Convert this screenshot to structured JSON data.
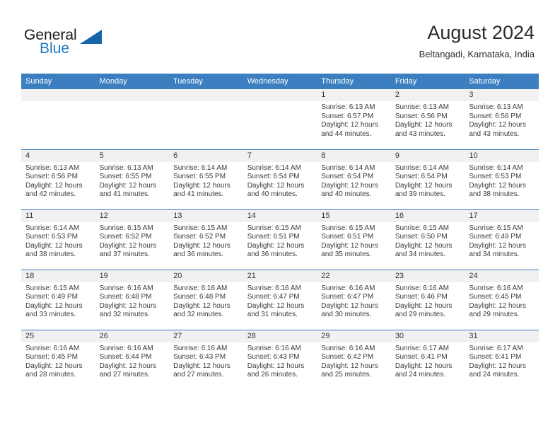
{
  "brand": {
    "name_part1": "General",
    "name_part2": "Blue"
  },
  "header": {
    "title": "August 2024",
    "subtitle": "Beltangadi, Karnataka, India"
  },
  "weekday_headers": [
    "Sunday",
    "Monday",
    "Tuesday",
    "Wednesday",
    "Thursday",
    "Friday",
    "Saturday"
  ],
  "colors": {
    "header_blue": "#3c7fc1",
    "band_gray": "#f1f1f1",
    "logo_blue": "#1f7cc4",
    "text": "#3b3b3b"
  },
  "labels": {
    "sunrise_prefix": "Sunrise:",
    "sunset_prefix": "Sunset:",
    "daylight_prefix": "Daylight:"
  },
  "weeks": [
    [
      {
        "day": "",
        "sunrise": "",
        "sunset": "",
        "daylight_l1": "",
        "daylight_l2": "",
        "empty": true
      },
      {
        "day": "",
        "sunrise": "",
        "sunset": "",
        "daylight_l1": "",
        "daylight_l2": "",
        "empty": true
      },
      {
        "day": "",
        "sunrise": "",
        "sunset": "",
        "daylight_l1": "",
        "daylight_l2": "",
        "empty": true
      },
      {
        "day": "",
        "sunrise": "",
        "sunset": "",
        "daylight_l1": "",
        "daylight_l2": "",
        "empty": true
      },
      {
        "day": "1",
        "sunrise": "Sunrise: 6:13 AM",
        "sunset": "Sunset: 6:57 PM",
        "daylight_l1": "Daylight: 12 hours",
        "daylight_l2": "and 44 minutes.",
        "empty": false
      },
      {
        "day": "2",
        "sunrise": "Sunrise: 6:13 AM",
        "sunset": "Sunset: 6:56 PM",
        "daylight_l1": "Daylight: 12 hours",
        "daylight_l2": "and 43 minutes.",
        "empty": false
      },
      {
        "day": "3",
        "sunrise": "Sunrise: 6:13 AM",
        "sunset": "Sunset: 6:56 PM",
        "daylight_l1": "Daylight: 12 hours",
        "daylight_l2": "and 43 minutes.",
        "empty": false
      }
    ],
    [
      {
        "day": "4",
        "sunrise": "Sunrise: 6:13 AM",
        "sunset": "Sunset: 6:56 PM",
        "daylight_l1": "Daylight: 12 hours",
        "daylight_l2": "and 42 minutes.",
        "empty": false
      },
      {
        "day": "5",
        "sunrise": "Sunrise: 6:13 AM",
        "sunset": "Sunset: 6:55 PM",
        "daylight_l1": "Daylight: 12 hours",
        "daylight_l2": "and 41 minutes.",
        "empty": false
      },
      {
        "day": "6",
        "sunrise": "Sunrise: 6:14 AM",
        "sunset": "Sunset: 6:55 PM",
        "daylight_l1": "Daylight: 12 hours",
        "daylight_l2": "and 41 minutes.",
        "empty": false
      },
      {
        "day": "7",
        "sunrise": "Sunrise: 6:14 AM",
        "sunset": "Sunset: 6:54 PM",
        "daylight_l1": "Daylight: 12 hours",
        "daylight_l2": "and 40 minutes.",
        "empty": false
      },
      {
        "day": "8",
        "sunrise": "Sunrise: 6:14 AM",
        "sunset": "Sunset: 6:54 PM",
        "daylight_l1": "Daylight: 12 hours",
        "daylight_l2": "and 40 minutes.",
        "empty": false
      },
      {
        "day": "9",
        "sunrise": "Sunrise: 6:14 AM",
        "sunset": "Sunset: 6:54 PM",
        "daylight_l1": "Daylight: 12 hours",
        "daylight_l2": "and 39 minutes.",
        "empty": false
      },
      {
        "day": "10",
        "sunrise": "Sunrise: 6:14 AM",
        "sunset": "Sunset: 6:53 PM",
        "daylight_l1": "Daylight: 12 hours",
        "daylight_l2": "and 38 minutes.",
        "empty": false
      }
    ],
    [
      {
        "day": "11",
        "sunrise": "Sunrise: 6:14 AM",
        "sunset": "Sunset: 6:53 PM",
        "daylight_l1": "Daylight: 12 hours",
        "daylight_l2": "and 38 minutes.",
        "empty": false
      },
      {
        "day": "12",
        "sunrise": "Sunrise: 6:15 AM",
        "sunset": "Sunset: 6:52 PM",
        "daylight_l1": "Daylight: 12 hours",
        "daylight_l2": "and 37 minutes.",
        "empty": false
      },
      {
        "day": "13",
        "sunrise": "Sunrise: 6:15 AM",
        "sunset": "Sunset: 6:52 PM",
        "daylight_l1": "Daylight: 12 hours",
        "daylight_l2": "and 36 minutes.",
        "empty": false
      },
      {
        "day": "14",
        "sunrise": "Sunrise: 6:15 AM",
        "sunset": "Sunset: 6:51 PM",
        "daylight_l1": "Daylight: 12 hours",
        "daylight_l2": "and 36 minutes.",
        "empty": false
      },
      {
        "day": "15",
        "sunrise": "Sunrise: 6:15 AM",
        "sunset": "Sunset: 6:51 PM",
        "daylight_l1": "Daylight: 12 hours",
        "daylight_l2": "and 35 minutes.",
        "empty": false
      },
      {
        "day": "16",
        "sunrise": "Sunrise: 6:15 AM",
        "sunset": "Sunset: 6:50 PM",
        "daylight_l1": "Daylight: 12 hours",
        "daylight_l2": "and 34 minutes.",
        "empty": false
      },
      {
        "day": "17",
        "sunrise": "Sunrise: 6:15 AM",
        "sunset": "Sunset: 6:49 PM",
        "daylight_l1": "Daylight: 12 hours",
        "daylight_l2": "and 34 minutes.",
        "empty": false
      }
    ],
    [
      {
        "day": "18",
        "sunrise": "Sunrise: 6:15 AM",
        "sunset": "Sunset: 6:49 PM",
        "daylight_l1": "Daylight: 12 hours",
        "daylight_l2": "and 33 minutes.",
        "empty": false
      },
      {
        "day": "19",
        "sunrise": "Sunrise: 6:16 AM",
        "sunset": "Sunset: 6:48 PM",
        "daylight_l1": "Daylight: 12 hours",
        "daylight_l2": "and 32 minutes.",
        "empty": false
      },
      {
        "day": "20",
        "sunrise": "Sunrise: 6:16 AM",
        "sunset": "Sunset: 6:48 PM",
        "daylight_l1": "Daylight: 12 hours",
        "daylight_l2": "and 32 minutes.",
        "empty": false
      },
      {
        "day": "21",
        "sunrise": "Sunrise: 6:16 AM",
        "sunset": "Sunset: 6:47 PM",
        "daylight_l1": "Daylight: 12 hours",
        "daylight_l2": "and 31 minutes.",
        "empty": false
      },
      {
        "day": "22",
        "sunrise": "Sunrise: 6:16 AM",
        "sunset": "Sunset: 6:47 PM",
        "daylight_l1": "Daylight: 12 hours",
        "daylight_l2": "and 30 minutes.",
        "empty": false
      },
      {
        "day": "23",
        "sunrise": "Sunrise: 6:16 AM",
        "sunset": "Sunset: 6:46 PM",
        "daylight_l1": "Daylight: 12 hours",
        "daylight_l2": "and 29 minutes.",
        "empty": false
      },
      {
        "day": "24",
        "sunrise": "Sunrise: 6:16 AM",
        "sunset": "Sunset: 6:45 PM",
        "daylight_l1": "Daylight: 12 hours",
        "daylight_l2": "and 29 minutes.",
        "empty": false
      }
    ],
    [
      {
        "day": "25",
        "sunrise": "Sunrise: 6:16 AM",
        "sunset": "Sunset: 6:45 PM",
        "daylight_l1": "Daylight: 12 hours",
        "daylight_l2": "and 28 minutes.",
        "empty": false
      },
      {
        "day": "26",
        "sunrise": "Sunrise: 6:16 AM",
        "sunset": "Sunset: 6:44 PM",
        "daylight_l1": "Daylight: 12 hours",
        "daylight_l2": "and 27 minutes.",
        "empty": false
      },
      {
        "day": "27",
        "sunrise": "Sunrise: 6:16 AM",
        "sunset": "Sunset: 6:43 PM",
        "daylight_l1": "Daylight: 12 hours",
        "daylight_l2": "and 27 minutes.",
        "empty": false
      },
      {
        "day": "28",
        "sunrise": "Sunrise: 6:16 AM",
        "sunset": "Sunset: 6:43 PM",
        "daylight_l1": "Daylight: 12 hours",
        "daylight_l2": "and 26 minutes.",
        "empty": false
      },
      {
        "day": "29",
        "sunrise": "Sunrise: 6:16 AM",
        "sunset": "Sunset: 6:42 PM",
        "daylight_l1": "Daylight: 12 hours",
        "daylight_l2": "and 25 minutes.",
        "empty": false
      },
      {
        "day": "30",
        "sunrise": "Sunrise: 6:17 AM",
        "sunset": "Sunset: 6:41 PM",
        "daylight_l1": "Daylight: 12 hours",
        "daylight_l2": "and 24 minutes.",
        "empty": false
      },
      {
        "day": "31",
        "sunrise": "Sunrise: 6:17 AM",
        "sunset": "Sunset: 6:41 PM",
        "daylight_l1": "Daylight: 12 hours",
        "daylight_l2": "and 24 minutes.",
        "empty": false
      }
    ]
  ]
}
